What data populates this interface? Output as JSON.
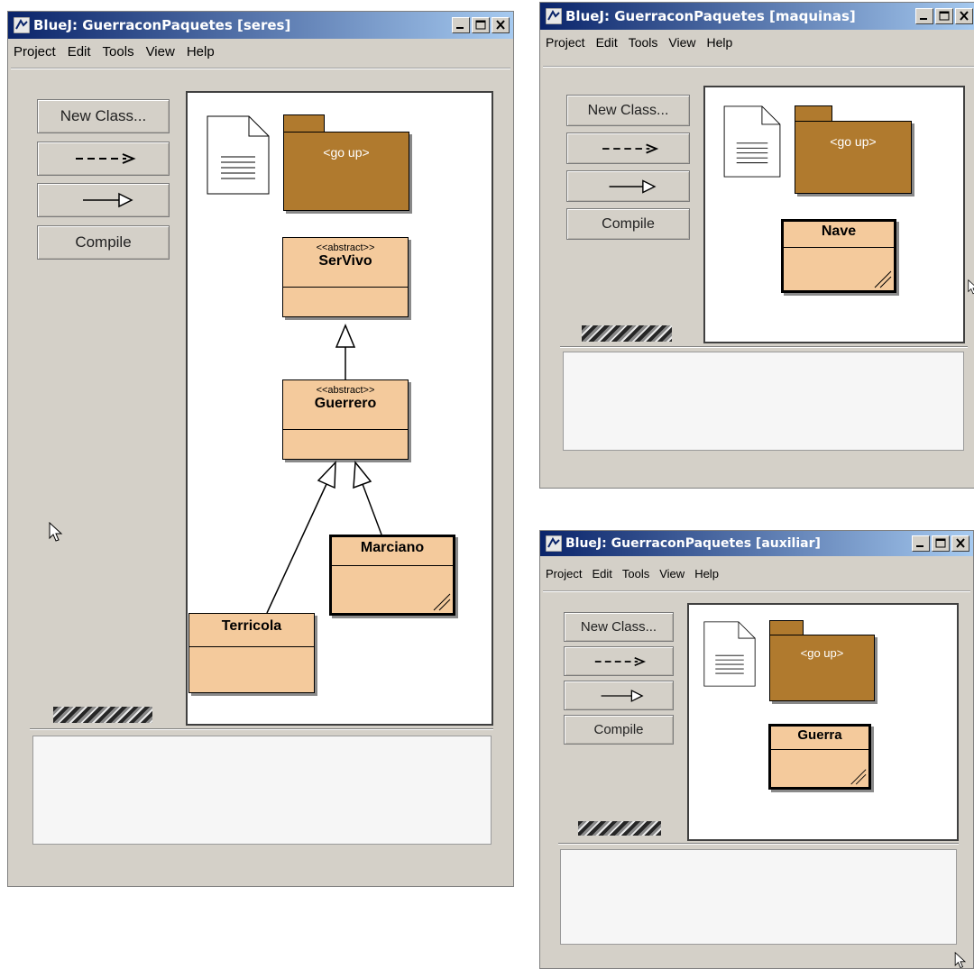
{
  "windows": {
    "seres": {
      "title": "BlueJ: GuerraconPaquetes [seres]"
    },
    "maquinas": {
      "title": "BlueJ: GuerraconPaquetes [maquinas]"
    },
    "auxiliar": {
      "title": "BlueJ: GuerraconPaquetes [auxiliar]"
    }
  },
  "menu": [
    "Project",
    "Edit",
    "Tools",
    "View",
    "Help"
  ],
  "toolbar": {
    "new_class": "New Class...",
    "dep_arrow": "--->",
    "compile": "Compile"
  },
  "package_up": "<go up>",
  "stereotype": "<<abstract>>",
  "classes": {
    "servivo": "SerVivo",
    "guerrero": "Guerrero",
    "marciano": "Marciano",
    "terricola": "Terricola",
    "nave": "Nave",
    "guerra": "Guerra"
  },
  "colors": {
    "title_gradient_start": "#0a246a",
    "title_gradient_end": "#a6caf0",
    "window_bg": "#d4d0c8",
    "class_fill": "#f4ca9c",
    "package_fill": "#b07a2e"
  }
}
